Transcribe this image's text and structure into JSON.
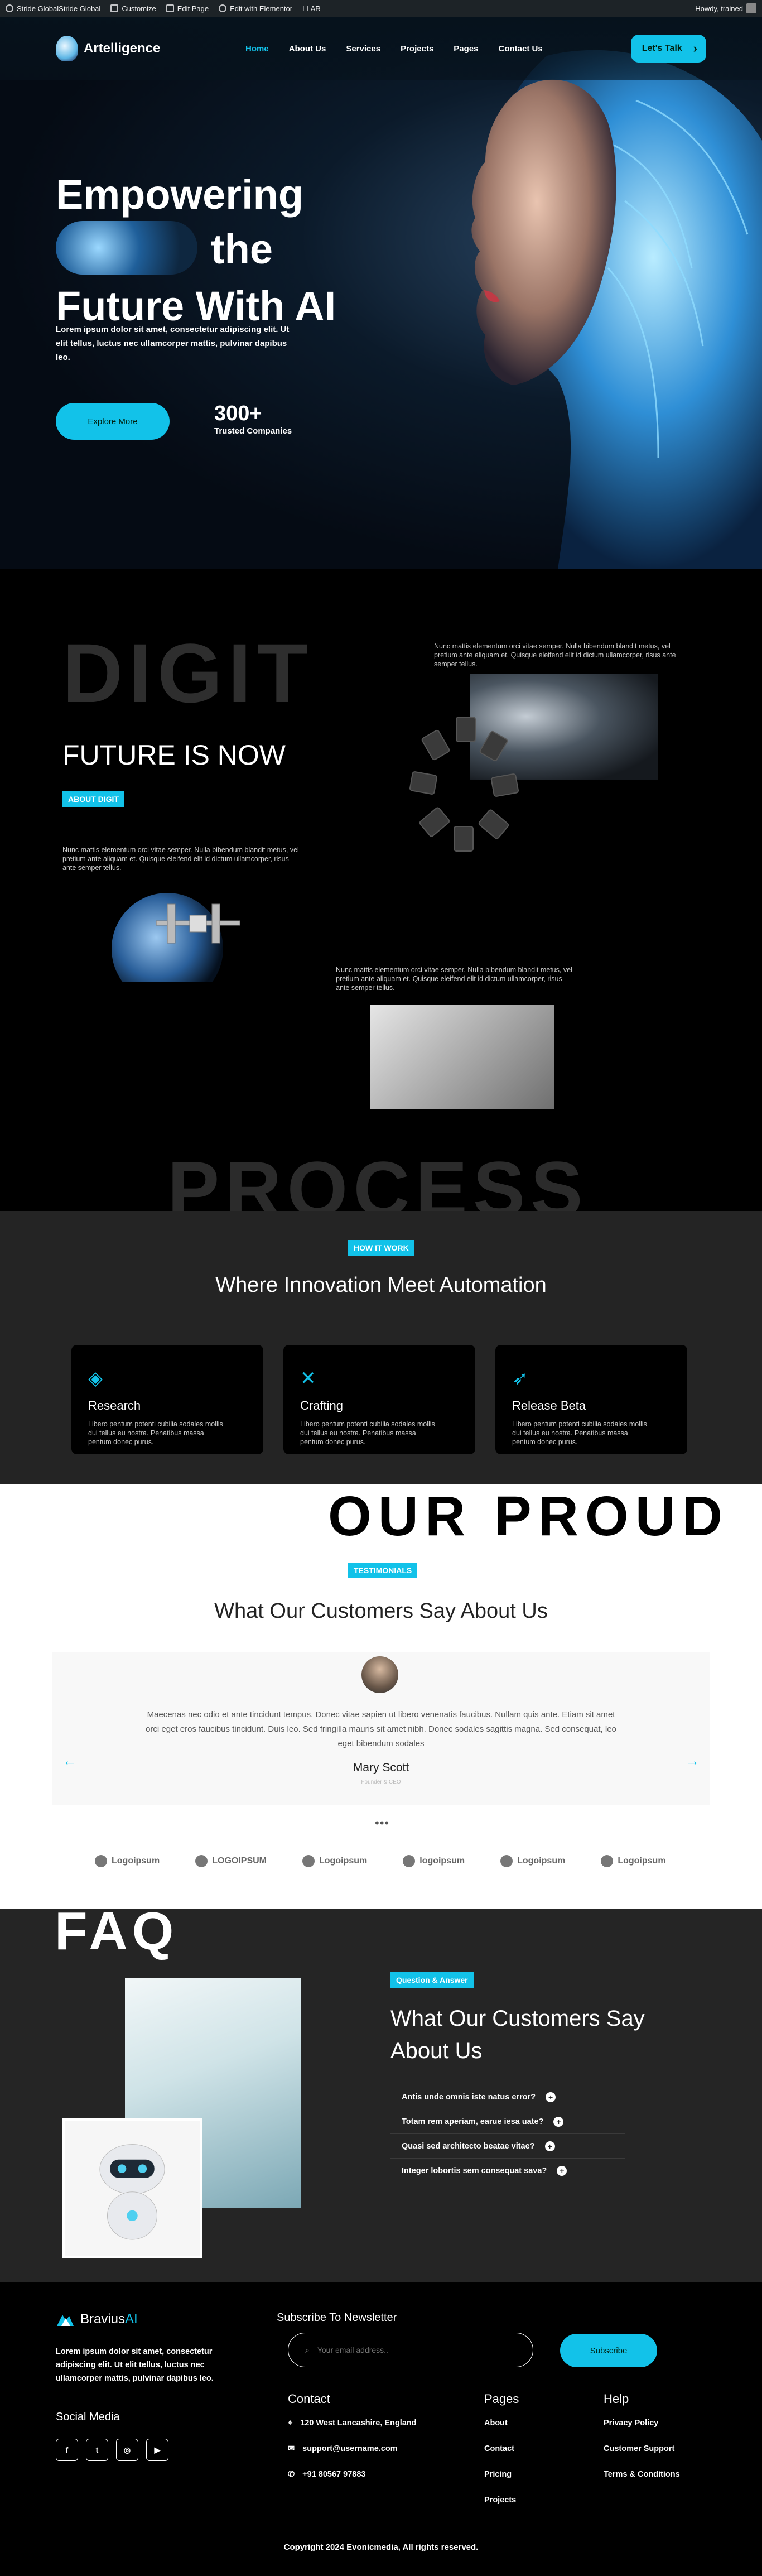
{
  "adminbar": {
    "site": "Stride GlobalStride Global",
    "customize": "Customize",
    "edit_page": "Edit Page",
    "edit_elementor": "Edit with Elementor",
    "llar": "LLAR",
    "howdy": "Howdy, trained"
  },
  "header": {
    "logo_text": "Artelligence",
    "nav": [
      "Home",
      "About Us",
      "Services",
      "Projects",
      "Pages",
      "Contact Us"
    ],
    "cta": "Let's Talk"
  },
  "hero": {
    "line1": "Empowering",
    "line2": "the",
    "line3": "Future With AI",
    "desc": "Lorem ipsum dolor sit amet, consectetur adipiscing elit. Ut elit tellus, luctus nec ullamcorper mattis, pulvinar dapibus leo.",
    "button": "Explore More",
    "stat_number": "300+",
    "stat_label": "Trusted Companies"
  },
  "digit": {
    "bigword": "DIGIT",
    "heading": "FUTURE IS NOW",
    "badge": "ABOUT DIGIT",
    "para": "Nunc mattis elementum orci vitae semper. Nulla bibendum blandit metus, vel pretium ante aliquam et. Quisque eleifend elit id dictum ullamcorper, risus ante semper tellus.",
    "process_word": "PROCESS"
  },
  "how": {
    "badge": "HOW IT WORK",
    "heading": "Where Innovation Meet Automation",
    "cards": [
      {
        "title": "Research",
        "desc": "Libero pentum potenti cubilia sodales mollis dui tellus eu nostra. Penatibus massa pentum donec purus."
      },
      {
        "title": "Crafting",
        "desc": "Libero pentum potenti cubilia sodales mollis dui tellus eu nostra. Penatibus massa pentum donec purus."
      },
      {
        "title": "Release Beta",
        "desc": "Libero pentum potenti cubilia sodales mollis dui tellus eu nostra. Penatibus massa pentum donec purus."
      }
    ]
  },
  "testimonials": {
    "bigword": "OUR PROUD",
    "badge": "TESTIMONIALS",
    "heading": "What Our Customers Say About Us",
    "quote": "Maecenas nec odio et ante tincidunt tempus. Donec vitae sapien ut libero venenatis faucibus. Nullam quis ante. Etiam sit amet orci eget eros faucibus tincidunt. Duis leo. Sed fringilla mauris sit amet nibh. Donec sodales sagittis magna. Sed consequat, leo eget bibendum sodales",
    "name": "Mary Scott",
    "role": "Founder & CEO",
    "logos": [
      "Logoipsum",
      "LOGOIPSUM",
      "Logoipsum",
      "logoipsum",
      "Logoipsum",
      "Logoipsum"
    ]
  },
  "faq": {
    "bigword": "FAQ",
    "badge": "Question & Answer",
    "heading": "What Our Customers Say About Us",
    "questions": [
      "Antis unde omnis iste natus error?",
      "Totam rem aperiam, earue iesa uate?",
      "Quasi sed architecto beatae vitae?",
      "Integer lobortis sem consequat sava?"
    ]
  },
  "footer": {
    "logo_part1": "Bravius",
    "logo_part2": "AI",
    "desc": "Lorem ipsum dolor sit amet, consectetur adipiscing elit. Ut elit tellus, luctus nec ullamcorper mattis, pulvinar dapibus leo.",
    "social_heading": "Social Media",
    "newsletter_heading": "Subscribe To Newsletter",
    "email_placeholder": "Your email address..",
    "subscribe": "Subscribe",
    "contact_heading": "Contact",
    "contact": [
      "120 West Lancashire, England",
      "support@username.com",
      "+91 80567 97883"
    ],
    "pages_heading": "Pages",
    "pages": [
      "About",
      "Contact",
      "Pricing",
      "Projects"
    ],
    "help_heading": "Help",
    "help": [
      "Privacy Policy",
      "Customer Support",
      "Terms & Conditions"
    ],
    "copyright": "Copyright 2024 Evonicmedia, All rights reserved."
  },
  "colors": {
    "accent": "#12c2e9",
    "dark": "#000000",
    "panel": "#242424"
  }
}
